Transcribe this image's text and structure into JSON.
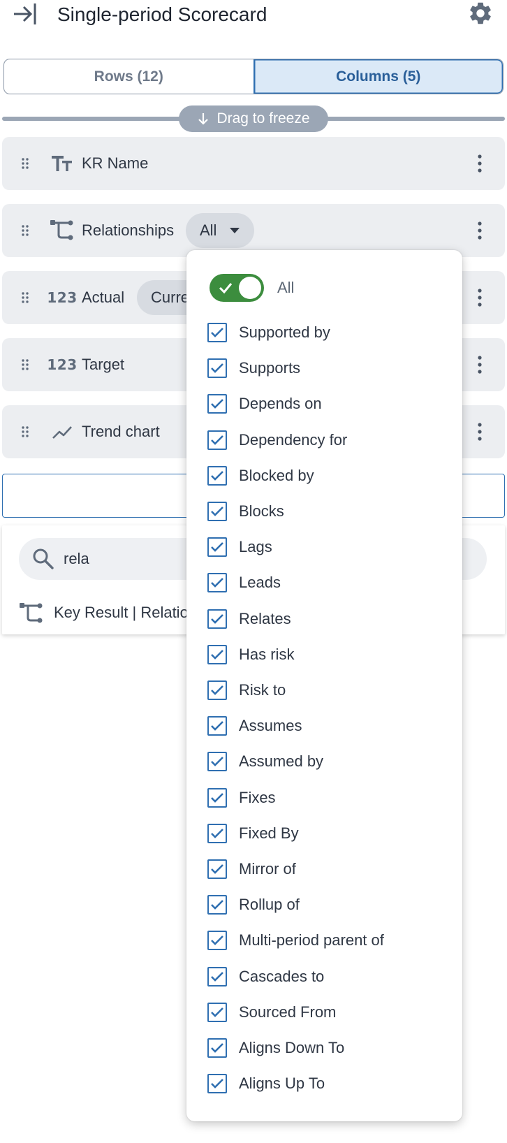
{
  "header": {
    "title": "Single-period Scorecard"
  },
  "tabs": {
    "rows": "Rows (12)",
    "columns": "Columns (5)"
  },
  "freeze": {
    "label": "Drag to freeze"
  },
  "columns": [
    {
      "label": "KR Name",
      "icon": "text-type-icon"
    },
    {
      "label": "Relationships",
      "icon": "relationship-icon",
      "chip": "All"
    },
    {
      "label": "Actual",
      "icon": "number-type-icon",
      "chip": "Curre"
    },
    {
      "label": "Target",
      "icon": "number-type-icon"
    },
    {
      "label": "Trend chart",
      "icon": "trend-icon"
    }
  ],
  "number_icon_text": "123",
  "search": {
    "value": "rela",
    "result": "Key Result | Relatio"
  },
  "dropdown": {
    "all_label": "All",
    "all_enabled": true,
    "options": [
      "Supported by",
      "Supports",
      "Depends on",
      "Dependency for",
      "Blocked by",
      "Blocks",
      "Lags",
      "Leads",
      "Relates",
      "Has risk",
      "Risk to",
      "Assumes",
      "Assumed by",
      "Fixes",
      "Fixed By",
      "Mirror of",
      "Rollup of",
      "Multi-period parent of",
      "Cascades to",
      "Sourced From",
      "Aligns Down To",
      "Aligns Up To"
    ]
  },
  "colors": {
    "accent": "#2f6fb1",
    "toggle": "#3c8d3e",
    "row_bg": "#eceef1"
  }
}
